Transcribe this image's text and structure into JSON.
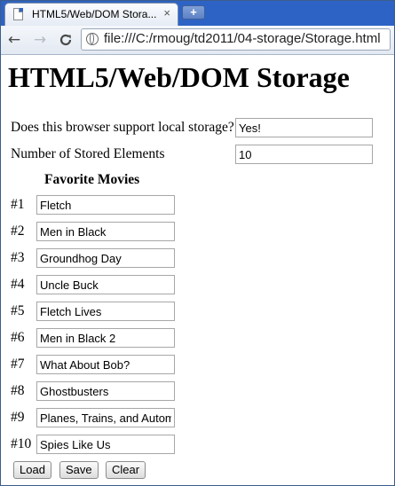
{
  "browser": {
    "tab_title": "HTML5/Web/DOM Stora...",
    "tab_close": "×",
    "new_tab": "+",
    "back": "←",
    "forward": "→",
    "reload": "C",
    "url": "file:///C:/rmoug/td2011/04-storage/Storage.html"
  },
  "page": {
    "title": "HTML5/Web/DOM Storage",
    "support_label": "Does this browser support local storage?",
    "support_value": "Yes!",
    "count_label": "Number of Stored Elements",
    "count_value": "10",
    "movies_heading": "Favorite Movies",
    "movies": [
      {
        "rank": "#1",
        "title": "Fletch"
      },
      {
        "rank": "#2",
        "title": "Men in Black"
      },
      {
        "rank": "#3",
        "title": "Groundhog Day"
      },
      {
        "rank": "#4",
        "title": "Uncle Buck"
      },
      {
        "rank": "#5",
        "title": "Fletch Lives"
      },
      {
        "rank": "#6",
        "title": "Men in Black 2"
      },
      {
        "rank": "#7",
        "title": "What About Bob?"
      },
      {
        "rank": "#8",
        "title": "Ghostbusters"
      },
      {
        "rank": "#9",
        "title": "Planes, Trains, and Autom"
      },
      {
        "rank": "#10",
        "title": "Spies Like Us"
      }
    ],
    "buttons": {
      "load": "Load",
      "save": "Save",
      "clear": "Clear"
    }
  }
}
